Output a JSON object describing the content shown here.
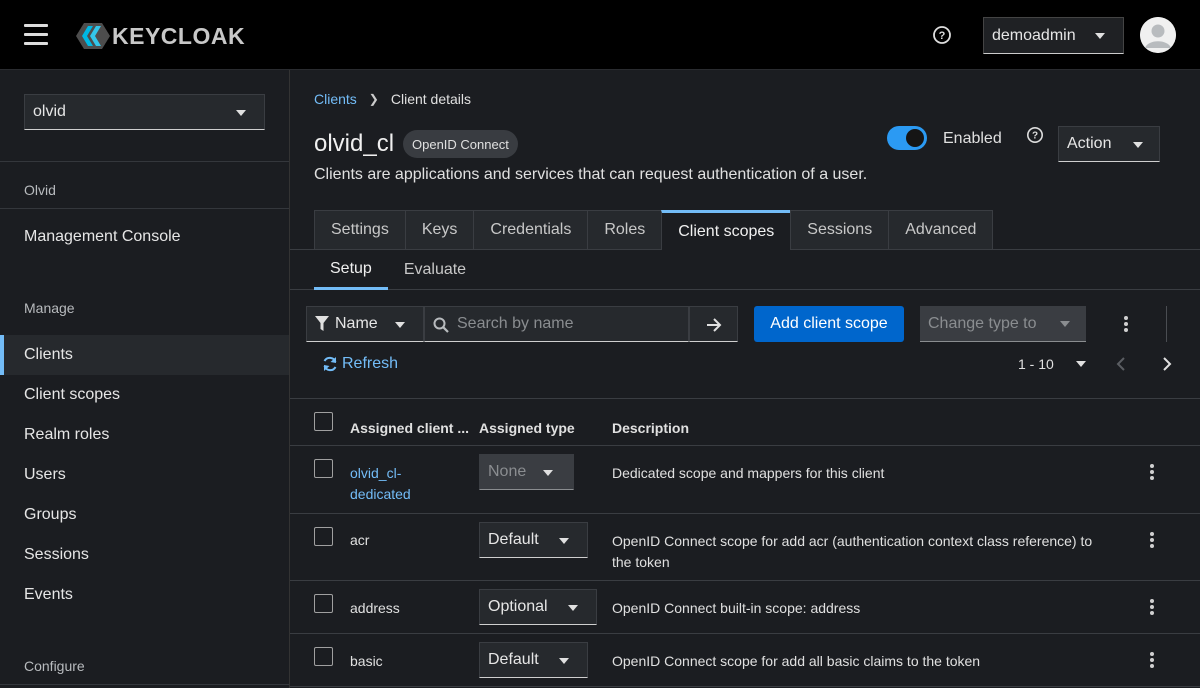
{
  "masthead": {
    "brand": "KEYCLOAK",
    "user": "demoadmin"
  },
  "sidebar": {
    "realm": "olvid",
    "realm_label": "Olvid",
    "console": "Management Console",
    "manage_heading": "Manage",
    "items": [
      {
        "label": "Clients"
      },
      {
        "label": "Client scopes"
      },
      {
        "label": "Realm roles"
      },
      {
        "label": "Users"
      },
      {
        "label": "Groups"
      },
      {
        "label": "Sessions"
      },
      {
        "label": "Events"
      }
    ],
    "configure_heading": "Configure"
  },
  "breadcrumb": {
    "parent": "Clients",
    "current": "Client details"
  },
  "header": {
    "title": "olvid_cl",
    "badge": "OpenID Connect",
    "subtitle": "Clients are applications and services that can request authentication of a user.",
    "enabled_label": "Enabled",
    "enabled": true,
    "action_label": "Action"
  },
  "tabs": [
    {
      "label": "Settings"
    },
    {
      "label": "Keys"
    },
    {
      "label": "Credentials"
    },
    {
      "label": "Roles"
    },
    {
      "label": "Client scopes"
    },
    {
      "label": "Sessions"
    },
    {
      "label": "Advanced"
    }
  ],
  "subtabs": [
    {
      "label": "Setup"
    },
    {
      "label": "Evaluate"
    }
  ],
  "toolbar": {
    "filter_label": "Name",
    "search_placeholder": "Search by name",
    "add_label": "Add client scope",
    "change_type_label": "Change type to",
    "refresh_label": "Refresh",
    "pagination": "1 - 10"
  },
  "table": {
    "columns": [
      "Assigned client ...",
      "Assigned type",
      "Description"
    ],
    "rows": [
      {
        "name": "olvid_cl-dedicated",
        "name_line1": "olvid_cl-",
        "name_line2": "dedicated",
        "type": "None",
        "description": "Dedicated scope and mappers for this client"
      },
      {
        "name": "acr",
        "type": "Default",
        "description_line1": "OpenID Connect scope for add acr (authentication context class reference) to",
        "description_line2": "the token"
      },
      {
        "name": "address",
        "type": "Optional",
        "description": "OpenID Connect built-in scope: address"
      },
      {
        "name": "basic",
        "type": "Default",
        "description": "OpenID Connect scope for add all basic claims to the token"
      }
    ]
  },
  "colors": {
    "accent": "#73bcf7",
    "primary": "#0066cc",
    "toggle_on": "#2b9af3",
    "background": "#1b1d21",
    "masthead": "#000000"
  }
}
